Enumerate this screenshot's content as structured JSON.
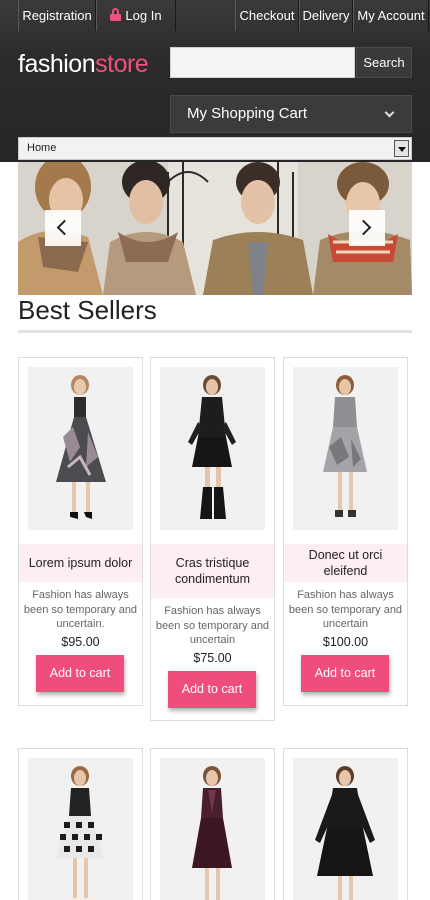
{
  "topbar": {
    "registration": "Registration",
    "login": "Log In",
    "checkout": "Checkout",
    "delivery": "Delivery",
    "my_account": "My Account"
  },
  "logo": {
    "part1": "fashion",
    "part2": "store"
  },
  "search": {
    "placeholder": "",
    "button": "Search"
  },
  "cart": {
    "label": "My Shopping Cart"
  },
  "nav": {
    "selected": "Home"
  },
  "section": {
    "title": "Best Sellers"
  },
  "products": [
    {
      "name": "Lorem ipsum dolor",
      "desc": "Fashion has always been so temporary and uncertain.",
      "price": "$95.00",
      "button": "Add to cart"
    },
    {
      "name": "Cras tristique condimentum",
      "desc": "Fashion has always been so temporary and uncertain",
      "price": "$75.00",
      "button": "Add to cart"
    },
    {
      "name": "Donec ut orci eleifend",
      "desc": "Fashion has always been so temporary and uncertain",
      "price": "$100.00",
      "button": "Add to cart"
    }
  ],
  "colors": {
    "accent": "#ef4d7b",
    "header_bg": "#2b2b2b",
    "name_bg": "#fdeef3"
  }
}
